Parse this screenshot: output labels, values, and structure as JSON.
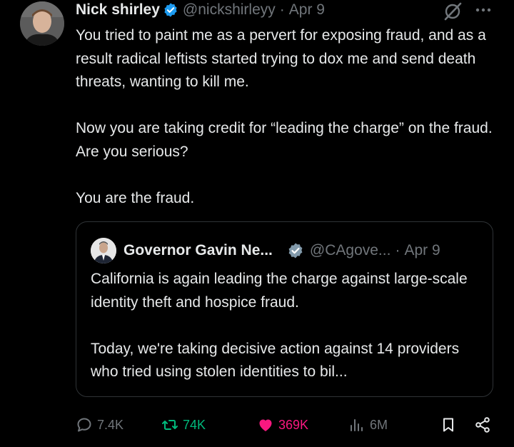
{
  "tweet": {
    "author_name": "Nick shirley",
    "handle": "@nickshirleyy",
    "date": "Apr 9",
    "separator": "·",
    "paragraphs": [
      "You tried to paint me as a pervert for exposing fraud, and as a result radical leftists started trying to dox me and send death threats, wanting to kill me.",
      "Now you are taking credit for “leading the charge” on the fraud. Are you serious?",
      "You are the fraud."
    ]
  },
  "quoted_tweet": {
    "author_name": "Governor Gavin Ne...",
    "handle": "@CAgove...",
    "date": "Apr 9",
    "separator": "·",
    "paragraphs": [
      "California is again leading the charge against large-scale identity theft and hospice fraud.",
      "Today, we're taking decisive action against 14 providers who tried using stolen identities to bil..."
    ]
  },
  "actions": {
    "replies": "7.4K",
    "reposts": "74K",
    "likes": "369K",
    "views": "6M"
  },
  "colors": {
    "background": "#000000",
    "text": "#e7e9ea",
    "muted": "#71767b",
    "verified_blue": "#1d9bf0",
    "repost_green": "#00ba7c",
    "like_pink": "#f91880",
    "border": "#2f3336"
  },
  "icons": [
    "verified-badge-icon",
    "grok-icon",
    "more-icon",
    "reply-icon",
    "repost-icon",
    "like-icon",
    "views-icon",
    "bookmark-icon",
    "share-icon"
  ]
}
